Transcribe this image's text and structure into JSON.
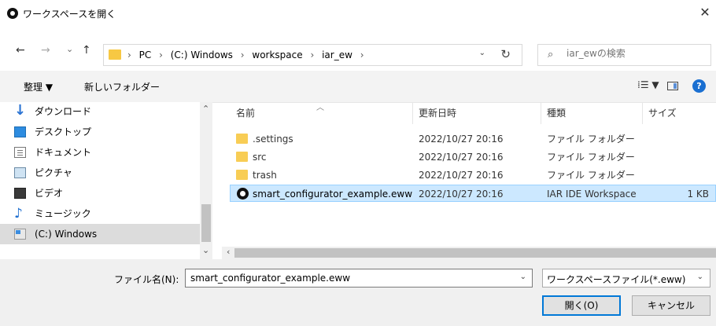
{
  "window": {
    "title": "ワークスペースを開く"
  },
  "nav": {
    "back": "←",
    "forward": "→",
    "recent": "⌄",
    "up": "↑",
    "crumbs": [
      "PC",
      "(C:) Windows",
      "workspace",
      "iar_ew"
    ],
    "crumb_sep": "›",
    "refresh": "↻",
    "search_placeholder": "iar_ewの検索"
  },
  "toolbar": {
    "organize": "整理 ▼",
    "new_folder": "新しいフォルダー",
    "view": "⁞☰ ▼",
    "help": "?"
  },
  "sidebar": {
    "items": [
      {
        "label": "ダウンロード",
        "icon": "download-icon"
      },
      {
        "label": "デスクトップ",
        "icon": "desktop-icon"
      },
      {
        "label": "ドキュメント",
        "icon": "documents-icon"
      },
      {
        "label": "ピクチャ",
        "icon": "pictures-icon"
      },
      {
        "label": "ビデオ",
        "icon": "videos-icon"
      },
      {
        "label": "ミュージック",
        "icon": "music-icon"
      },
      {
        "label": "(C:) Windows",
        "icon": "drive-icon",
        "selected": true
      }
    ]
  },
  "files": {
    "columns": {
      "name": "名前",
      "date": "更新日時",
      "type": "種類",
      "size": "サイズ"
    },
    "rows": [
      {
        "name": ".settings",
        "date": "2022/10/27 20:16",
        "type": "ファイル フォルダー",
        "size": "",
        "icon": "folder-icon"
      },
      {
        "name": "src",
        "date": "2022/10/27 20:16",
        "type": "ファイル フォルダー",
        "size": "",
        "icon": "folder-icon"
      },
      {
        "name": "trash",
        "date": "2022/10/27 20:16",
        "type": "ファイル フォルダー",
        "size": "",
        "icon": "folder-icon"
      },
      {
        "name": "smart_configurator_example.eww",
        "date": "2022/10/27 20:16",
        "type": "IAR IDE Workspace",
        "size": "1 KB",
        "icon": "iar-workspace-icon",
        "selected": true
      }
    ]
  },
  "footer": {
    "filename_label": "ファイル名(N):",
    "filename_value": "smart_configurator_example.eww",
    "filetype": "ワークスペースファイル(*.eww)",
    "open_button": "開く(O)",
    "cancel_button": "キャンセル"
  },
  "colors": {
    "selection": "#cce8ff",
    "accent": "#0078d7",
    "folder": "#f8cd55"
  }
}
